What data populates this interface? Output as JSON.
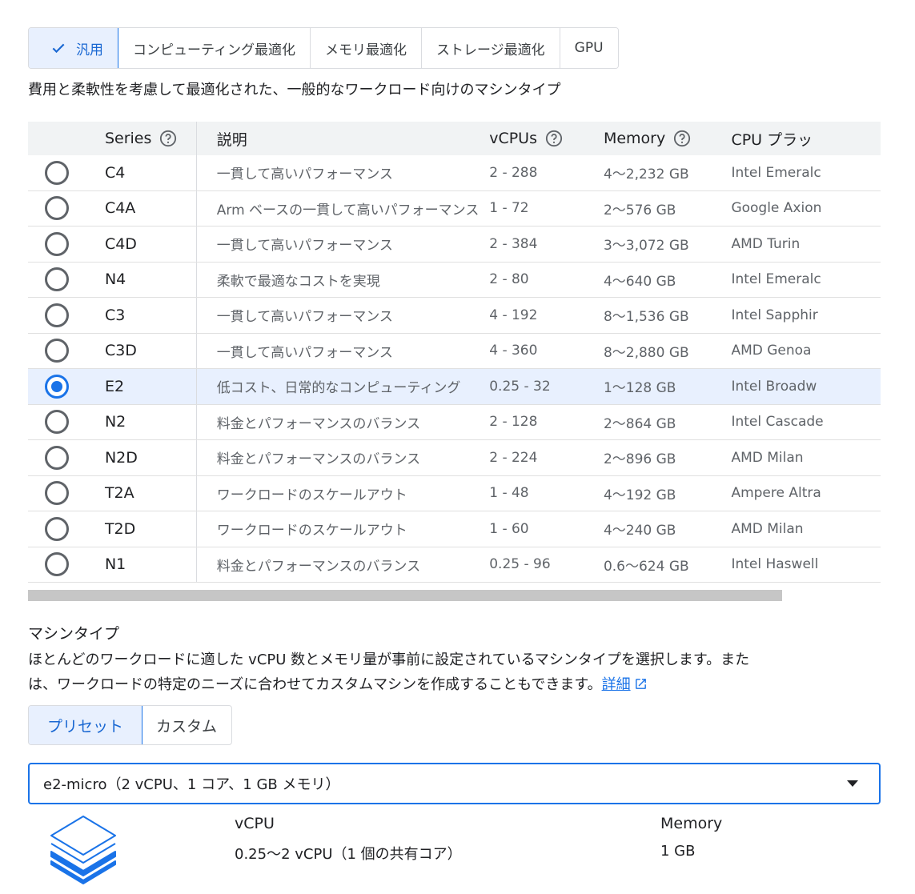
{
  "family_tabs": [
    {
      "label": "汎用",
      "active": true
    },
    {
      "label": "コンピューティング最適化",
      "active": false
    },
    {
      "label": "メモリ最適化",
      "active": false
    },
    {
      "label": "ストレージ最適化",
      "active": false
    },
    {
      "label": "GPU",
      "active": false
    }
  ],
  "family_description": "費用と柔軟性を考慮して最適化された、一般的なワークロード向けのマシンタイプ",
  "table": {
    "headers": {
      "series": "Series",
      "description": "説明",
      "vcpus": "vCPUs",
      "memory": "Memory",
      "cpu_platform": "CPU プラッ"
    },
    "rows": [
      {
        "series": "C4",
        "description": "一貫して高いパフォーマンス",
        "vcpus": "2 - 288",
        "memory": "4〜2,232 GB",
        "cpu": "Intel Emeralc",
        "selected": false
      },
      {
        "series": "C4A",
        "description": "Arm ベースの一貫して高いパフォーマンス",
        "vcpus": "1 - 72",
        "memory": "2〜576 GB",
        "cpu": "Google Axion",
        "selected": false
      },
      {
        "series": "C4D",
        "description": "一貫して高いパフォーマンス",
        "vcpus": "2 - 384",
        "memory": "3〜3,072 GB",
        "cpu": "AMD Turin",
        "selected": false
      },
      {
        "series": "N4",
        "description": "柔軟で最適なコストを実現",
        "vcpus": "2 - 80",
        "memory": "4〜640 GB",
        "cpu": "Intel Emeralc",
        "selected": false
      },
      {
        "series": "C3",
        "description": "一貫して高いパフォーマンス",
        "vcpus": "4 - 192",
        "memory": "8〜1,536 GB",
        "cpu": "Intel Sapphir",
        "selected": false
      },
      {
        "series": "C3D",
        "description": "一貫して高いパフォーマンス",
        "vcpus": "4 - 360",
        "memory": "8〜2,880 GB",
        "cpu": "AMD Genoa",
        "selected": false
      },
      {
        "series": "E2",
        "description": "低コスト、日常的なコンピューティング",
        "vcpus": "0.25 - 32",
        "memory": "1〜128 GB",
        "cpu": "Intel Broadw",
        "selected": true
      },
      {
        "series": "N2",
        "description": "料金とパフォーマンスのバランス",
        "vcpus": "2 - 128",
        "memory": "2〜864 GB",
        "cpu": "Intel Cascade",
        "selected": false
      },
      {
        "series": "N2D",
        "description": "料金とパフォーマンスのバランス",
        "vcpus": "2 - 224",
        "memory": "2〜896 GB",
        "cpu": "AMD Milan",
        "selected": false
      },
      {
        "series": "T2A",
        "description": "ワークロードのスケールアウト",
        "vcpus": "1 - 48",
        "memory": "4〜192 GB",
        "cpu": "Ampere Altra",
        "selected": false
      },
      {
        "series": "T2D",
        "description": "ワークロードのスケールアウト",
        "vcpus": "1 - 60",
        "memory": "4〜240 GB",
        "cpu": "AMD Milan",
        "selected": false
      },
      {
        "series": "N1",
        "description": "料金とパフォーマンスのバランス",
        "vcpus": "0.25 - 96",
        "memory": "0.6〜624 GB",
        "cpu": "Intel Haswell",
        "selected": false
      }
    ]
  },
  "machine_type": {
    "title": "マシンタイプ",
    "description_line1": "ほとんどのワークロードに適した vCPU 数とメモリ量が事前に設定されているマシンタイプを選択します。また",
    "description_line2": "は、ワークロードの特定のニーズに合わせてカスタムマシンを作成することもできます。",
    "link_label": "詳細",
    "tabs": [
      {
        "label": "プリセット",
        "active": true
      },
      {
        "label": "カスタム",
        "active": false
      }
    ],
    "selected_value": "e2-micro（2 vCPU、1 コア、1 GB メモリ）",
    "spec": {
      "vcpu_label": "vCPU",
      "vcpu_value": "0.25〜2 vCPU（1 個の共有コア）",
      "memory_label": "Memory",
      "memory_value": "1 GB"
    }
  },
  "icons": {
    "check": "check-icon",
    "help": "help-circle-icon",
    "external": "external-link-icon",
    "dropdown": "caret-down-icon",
    "stack": "layers-stack-icon"
  },
  "colors": {
    "accent": "#1a73e8",
    "accent_bg": "#e8f0fe",
    "header_bg": "#f1f3f4"
  }
}
